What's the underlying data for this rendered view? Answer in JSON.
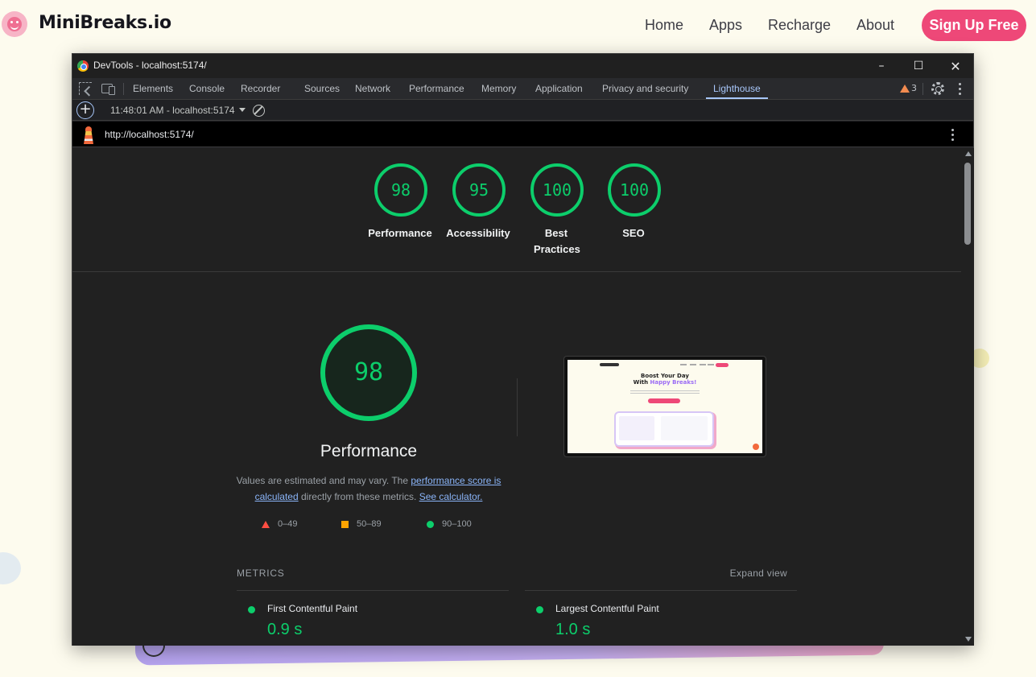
{
  "site": {
    "brand": "MiniBreaks.io",
    "nav": [
      "Home",
      "Apps",
      "Recharge",
      "About"
    ],
    "signup_label": "Sign Up Free",
    "accent": "#ee4878"
  },
  "devtools": {
    "window_title": "DevTools - localhost:5174/",
    "window_controls": {
      "minimize": "–",
      "maximize": "☐",
      "close": "✕"
    },
    "tabs": [
      "Elements",
      "Console",
      "Recorder",
      "Sources",
      "Network",
      "Performance",
      "Memory",
      "Application",
      "Privacy and security",
      "Lighthouse"
    ],
    "active_tab": "Lighthouse",
    "warning_count": "3",
    "run_selector": "11:48:01 AM - localhost:5174",
    "new_report_label": "+",
    "url": "http://localhost:5174/"
  },
  "scores": [
    {
      "label": "Performance",
      "value": "98"
    },
    {
      "label": "Accessibility",
      "value": "95"
    },
    {
      "label": "Best Practices",
      "value": "100"
    },
    {
      "label": "SEO",
      "value": "100"
    }
  ],
  "performance": {
    "score": "98",
    "title": "Performance",
    "desc_prefix": "Values are estimated and may vary. The ",
    "desc_link1": "performance score is calculated",
    "desc_middle": " directly from these metrics. ",
    "desc_link2": "See calculator.",
    "legend": {
      "fail": "0–49",
      "average": "50–89",
      "pass": "90–100"
    },
    "colors": {
      "pass": "#0cce6b",
      "average": "#ffa400",
      "fail": "#ff4e42"
    }
  },
  "thumbnail": {
    "headline_1": "Boost Your Day",
    "headline_2_prefix": "With ",
    "headline_2_highlight": "Happy Breaks!"
  },
  "metrics": {
    "title": "METRICS",
    "expand_label": "Expand view",
    "items": [
      {
        "name": "First Contentful Paint",
        "value": "0.9 s"
      },
      {
        "name": "Largest Contentful Paint",
        "value": "1.0 s"
      }
    ]
  }
}
